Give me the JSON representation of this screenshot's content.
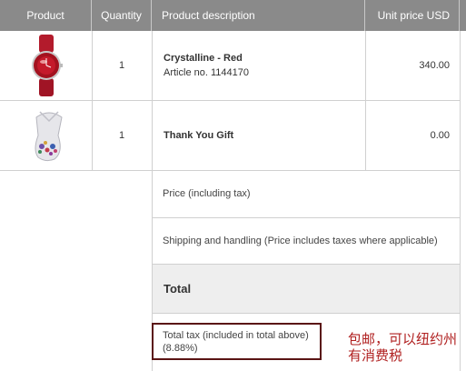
{
  "table": {
    "headers": {
      "product": "Product",
      "quantity": "Quantity",
      "description": "Product description",
      "unit_price": "Unit price USD"
    },
    "rows": [
      {
        "image_icon": "red-watch-image",
        "quantity": "1",
        "name": "Crystalline - Red",
        "article": "Article no. 1144170",
        "price": "340.00"
      },
      {
        "image_icon": "gift-bag-image",
        "quantity": "1",
        "name": "Thank You Gift",
        "article": "",
        "price": "0.00"
      }
    ]
  },
  "summary": {
    "price_label": "Price (including tax)",
    "shipping_label": "Shipping and handling (Price includes taxes where applicable)",
    "total_label": "Total",
    "tax_label_line1": "Total tax (included in total above)",
    "tax_label_line2": "(8.88%)"
  },
  "annotation": {
    "line1": "包邮，可以纽约州",
    "line2": "有消费税"
  },
  "colors": {
    "header_bg": "#8a8a8a",
    "annotation_box": "#5a1414",
    "annotation_text": "#b02020"
  }
}
